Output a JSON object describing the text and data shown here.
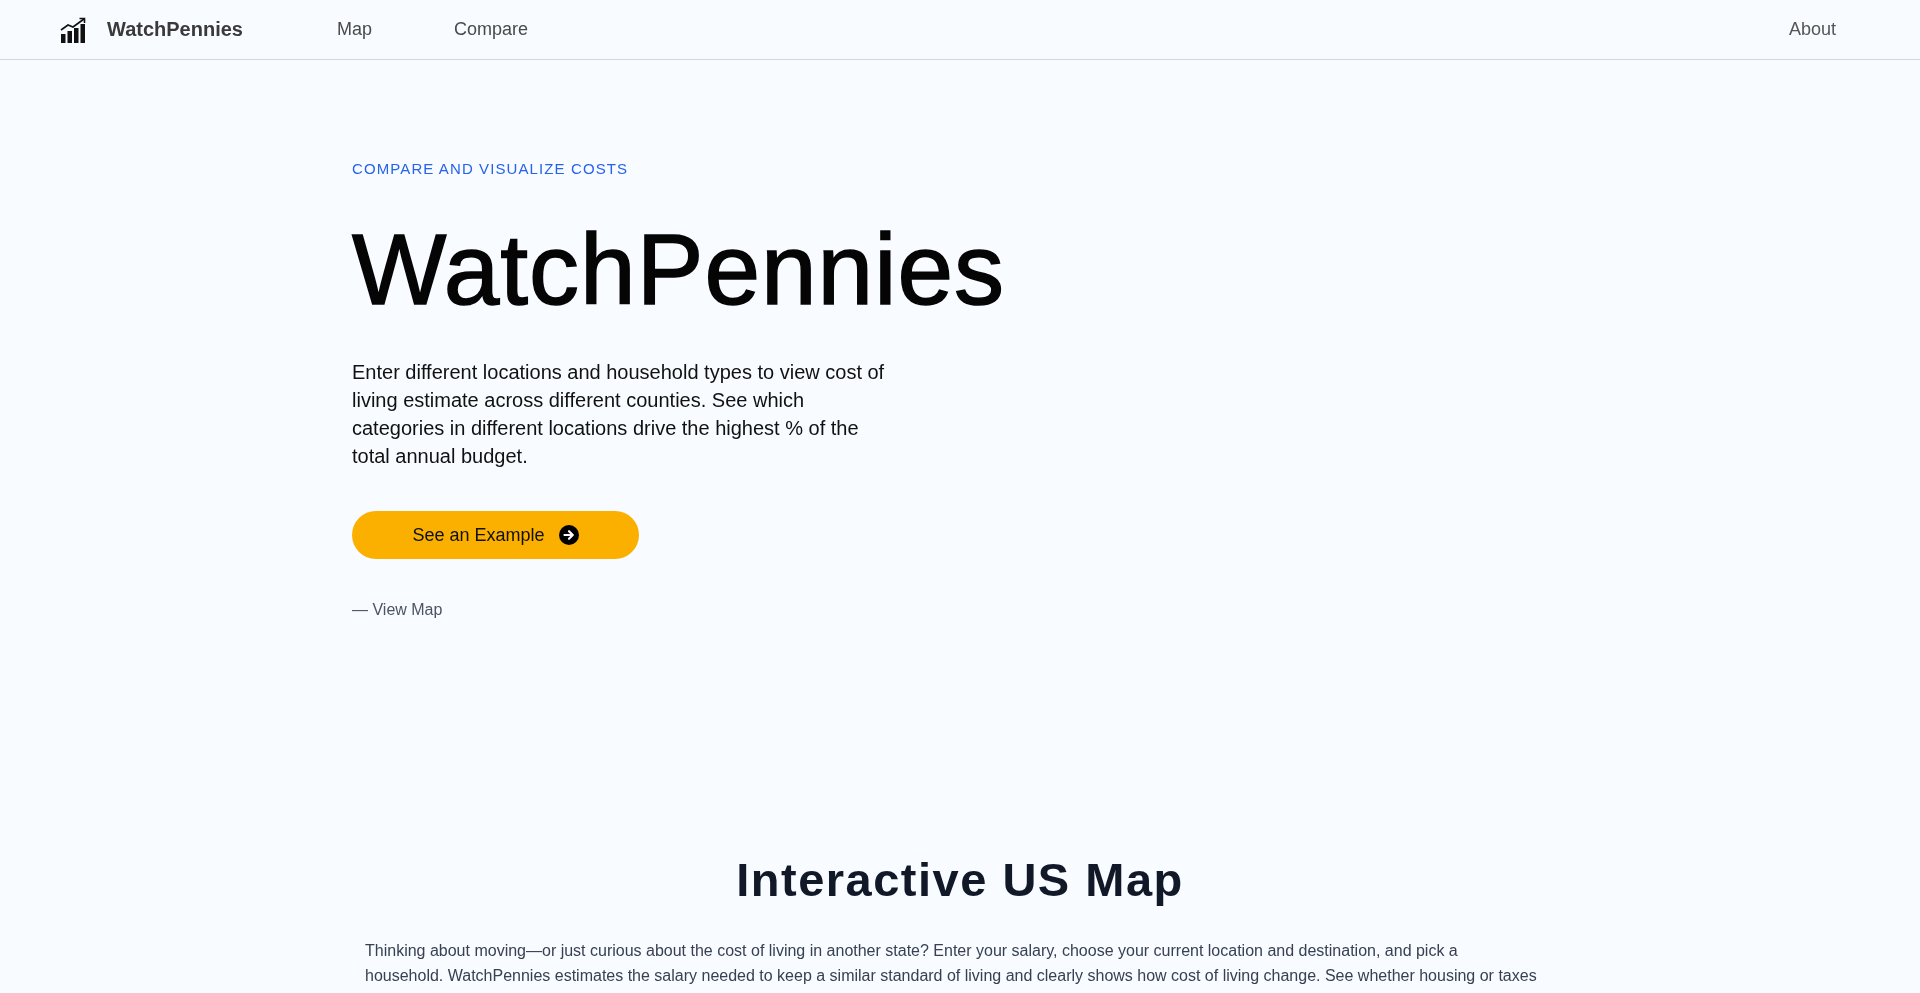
{
  "nav": {
    "brand": "WatchPennies",
    "links": [
      "Map",
      "Compare"
    ],
    "right_links": [
      "About"
    ]
  },
  "hero": {
    "eyebrow": "COMPARE AND VISUALIZE COSTS",
    "title": "WatchPennies",
    "description": "Enter different locations and household types to view cost of living estimate across different counties. See which categories in different locations drive the highest % of the total annual budget.",
    "cta": {
      "label": "See an Example"
    },
    "secondary_link": "— View Map"
  },
  "map_section": {
    "heading": "Interactive US Map",
    "intro_lines": [
      "Thinking about moving—or just curious about the cost of living in another state? Enter your salary, choose your current location and destination, and pick a",
      "household. WatchPennies estimates the salary needed to keep a similar standard of living and clearly shows how cost of living change. See whether housing or taxes"
    ]
  }
}
